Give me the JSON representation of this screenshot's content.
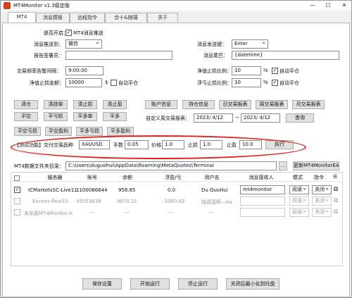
{
  "window": {
    "title": "MT4Monitor v1.3稳定版",
    "minimize": "—",
    "maximize": "☐",
    "close": "✕"
  },
  "tabs": [
    "MT4",
    "消息模板",
    "远程指令",
    "合十&随蒲",
    "关于"
  ],
  "settings": {
    "enable_label": "是否开启：",
    "enable_checkbox": "MT4消息推送",
    "enable_checked": true,
    "push_channel_label": "消息推送到：",
    "push_channel_value": "微信",
    "send_method_label": "消息发送键：",
    "send_method_value": "Enter",
    "sender_label": "报告签署员：",
    "sender_value": "",
    "msg_tail_label": "消息尾巴：",
    "msg_tail_value": "{datetime}",
    "interval_label": "交易频率告警间隔：",
    "interval_value": "9:00:00",
    "loss_ratio_label": "净值止损比例：",
    "loss_ratio_value": "10",
    "loss_ratio_unit": "%",
    "loss_auto_label": "自动平仓",
    "loss_auto_checked": true,
    "net_loss_label": "净值止损金额：",
    "net_loss_value": "10000",
    "net_loss_unit": "$",
    "net_auto_label": "自动平仓",
    "net_auto_checked": false,
    "float_loss_label": "浮亏止损比例：",
    "float_loss_value": "10",
    "float_loss_unit": "%",
    "float_auto_label": "自动平仓",
    "float_auto_checked": true
  },
  "buttons_row1": [
    "清仓",
    "清挂单",
    "清止损",
    "清止盈"
  ],
  "buttons_row2": [
    "平空",
    "平亏损",
    "平多单",
    "平多"
  ],
  "buttons_row3": [
    "平空亏损",
    "平空盈利",
    "平多亏损",
    "平多盈利"
  ],
  "report_buttons": [
    "账户信息",
    "持仓信息",
    "日交易报表",
    "周交易报表",
    "月交易报表"
  ],
  "custom_report": {
    "label": "自定义周交易报表：",
    "start_date": "2023/ 4/12",
    "separator": "~",
    "end_date": "2023/ 4/12",
    "query_button": "查询"
  },
  "test_trade": {
    "label": "【测试功能】交付交易：",
    "symbol_label": "品种",
    "symbol_value": "XAUUSD",
    "lots_label": "手数",
    "lots_value": "0.05",
    "price_label": "价格",
    "price_value": "1.0",
    "sl_label": "止损",
    "sl_value": "1.0",
    "tp_label": "止盈",
    "tp_value": "10.0",
    "execute_button": "执行"
  },
  "data_dir": {
    "label": "MT4数据文件夹目录：",
    "value": "C:\\Users\\duguohui\\AppData\\Roaming\\MetaQuotes\\Terminal",
    "browse": "...",
    "update_button": "更新MT4MonitorEA"
  },
  "table": {
    "headers": [
      "服务器",
      "账号",
      "余额",
      "浮盈/亏",
      "用户名",
      "消息接收人",
      "模式",
      "指令"
    ],
    "rows": [
      {
        "checked": true,
        "server": "ICMarketsSC-Live11",
        "account": "1100086844",
        "balance": "958.65",
        "pnl": "0.0",
        "user": "Du GuoHui",
        "receiver": "mt4monitor",
        "mode": "阅读",
        "cmd": "关闭",
        "dim": false
      },
      {
        "checked": false,
        "server": "Exness-Real15",
        "account": "45053839",
        "balance": "9870.21",
        "pnl": "-3080.62",
        "user": "独孤国辉—ea",
        "receiver": "",
        "mode": "阅读",
        "cmd": "关闭",
        "dim": true
      },
      {
        "checked": false,
        "server": "未安装MT4Monitor.A",
        "account": "---",
        "balance": "---",
        "pnl": "---",
        "user": "---",
        "receiver": "",
        "mode": "阅读",
        "cmd": "关闭",
        "dim": true
      }
    ]
  },
  "footer_buttons": [
    "保存设置",
    "开始运行",
    "停止运行",
    "关闭后最小化到托盘"
  ]
}
